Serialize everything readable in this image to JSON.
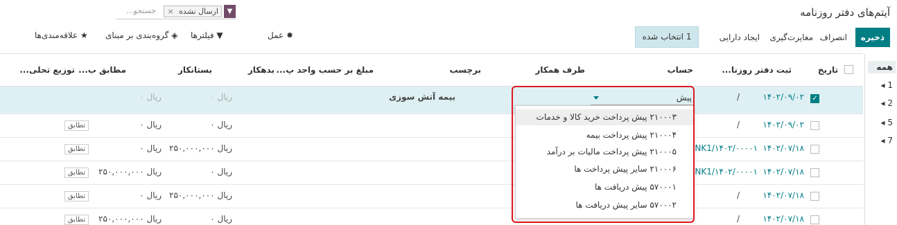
{
  "header": {
    "title": "آیتم‌های دفتر روزنامه",
    "search_placeholder": "جستجو...",
    "facet_label": "ارسال نشده",
    "facet_remove": "×"
  },
  "toolbar": {
    "save": "ذخیره",
    "discard": "انصراف",
    "reconcile": "مغایرت‌گیری",
    "create_asset": "ایجاد دارایی",
    "selected": "1 انتخاب شده",
    "action": "عمل",
    "filters": "فیلترها",
    "group_by": "گروه‌بندی بر مبنای",
    "favorites": "علاقه‌مندی‌ها"
  },
  "sidepanel": {
    "items": [
      "همه",
      "1",
      "2",
      "5",
      "7"
    ]
  },
  "columns": [
    "تاریخ",
    "ثبت دفتر روزنا...",
    "حساب",
    "طرف همکار",
    "برچسب",
    "مبلغ بر حسب واحد پ...",
    "بدهکار",
    "بستانکار",
    "مطابق ب...",
    "توزیع تحلی..."
  ],
  "rows": [
    {
      "date": "۱۴۰۲/۰۹/۰۲",
      "entry": "/",
      "account": "پیش",
      "partner": "",
      "label": "بیمه آتش سوزی",
      "debit": "ریال ۰",
      "credit": "ریال ۰",
      "match": "",
      "selected": true
    },
    {
      "date": "۱۴۰۲/۰۹/۰۲",
      "entry": "/",
      "account": "",
      "partner": "",
      "label": "",
      "debit": "ریال ۰",
      "credit": "ریال ۰",
      "match": "تطابق",
      "selected": false
    },
    {
      "date": "۱۴۰۲/۰۷/۱۸",
      "entry": "BNK1/۱۴۰۲/۰۰۰۰۱",
      "account": "",
      "partner": "",
      "label": "",
      "debit": "ریال ۲۵۰,۰۰۰,۰۰۰",
      "credit": "ریال ۰",
      "match": "تطابق",
      "selected": false
    },
    {
      "date": "۱۴۰۲/۰۷/۱۸",
      "entry": "BNK1/۱۴۰۲/۰۰۰۰۱",
      "account": "",
      "partner": "",
      "label": "",
      "debit": "ریال ۰",
      "credit": "ریال ۲۵۰,۰۰۰,۰۰۰",
      "match": "تطابق",
      "selected": false
    },
    {
      "date": "۱۴۰۲/۰۷/۱۸",
      "entry": "/",
      "account": "",
      "partner": "",
      "label": "",
      "debit": "ریال ۲۵۰,۰۰۰,۰۰۰",
      "credit": "ریال ۰",
      "match": "تطابق",
      "selected": false
    },
    {
      "date": "۱۴۰۲/۰۷/۱۸",
      "entry": "/",
      "account": "",
      "partner": "",
      "label": "",
      "debit": "ریال ۰",
      "credit": "ریال ۲۵۰,۰۰۰,۰۰۰",
      "match": "تطابق",
      "selected": false
    }
  ],
  "account_dropdown": {
    "value": "پیش",
    "options": [
      "۲۱۰۰۰۳ پیش پرداخت خرید کالا و خدمات",
      "۲۱۰۰۰۴ پیش پرداخت بیمه",
      "۲۱۰۰۰۵ پیش پرداخت مالیات بر درآمد",
      "۲۱۰۰۰۶ سایر پیش پرداخت ها",
      "۵۷۰۰۰۱ پیش دریافت ها",
      "۵۷۰۰۰۲ سایر پیش دریافت ها"
    ]
  },
  "colors": {
    "accent": "#017e84",
    "brand": "#714b67",
    "highlight_frame": "#e0161f"
  }
}
